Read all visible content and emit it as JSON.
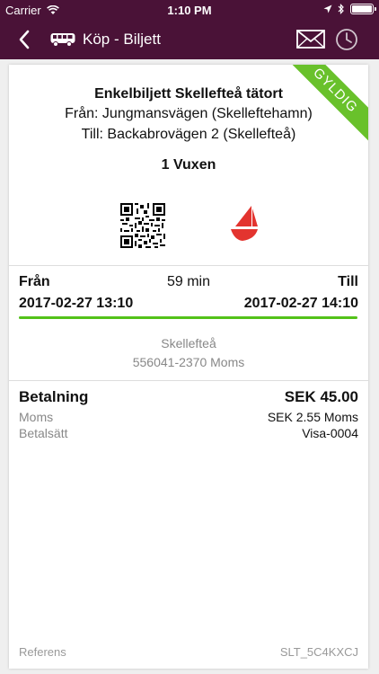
{
  "status_bar": {
    "carrier": "Carrier",
    "time": "1:10 PM",
    "battery_level": 1.0
  },
  "nav": {
    "title": "Köp - Biljett",
    "icons": {
      "back": "chevron-left-icon",
      "bus": "bus-icon",
      "mail": "mail-icon",
      "history": "clock-icon"
    }
  },
  "ticket": {
    "status": "GYLDIG",
    "title": "Enkelbiljett Skellefteå tätort",
    "from_line": "Från: Jungmansvägen (Skelleftehamn)",
    "to_line": "Till: Backabrovägen 2 (Skellefteå)",
    "passengers": "1 Vuxen"
  },
  "trip": {
    "from_label": "Från",
    "to_label": "Till",
    "duration": "59 min",
    "departure": "2017-02-27 13:10",
    "arrival": "2017-02-27 14:10",
    "progress": 1.0
  },
  "seller": {
    "name": "Skellefteå",
    "org": "556041-2370  Moms"
  },
  "payment": {
    "label": "Betalning",
    "amount": "SEK 45.00",
    "vat_label": "Moms",
    "vat_value": "SEK 2.55 Moms",
    "method_label": "Betalsätt",
    "method_value": "Visa-0004"
  },
  "reference": {
    "label": "Referens",
    "value": "SLT_5C4KXCJ"
  },
  "colors": {
    "brand": "#4a1237",
    "valid": "#69c12b",
    "logo": "#e3342f"
  }
}
